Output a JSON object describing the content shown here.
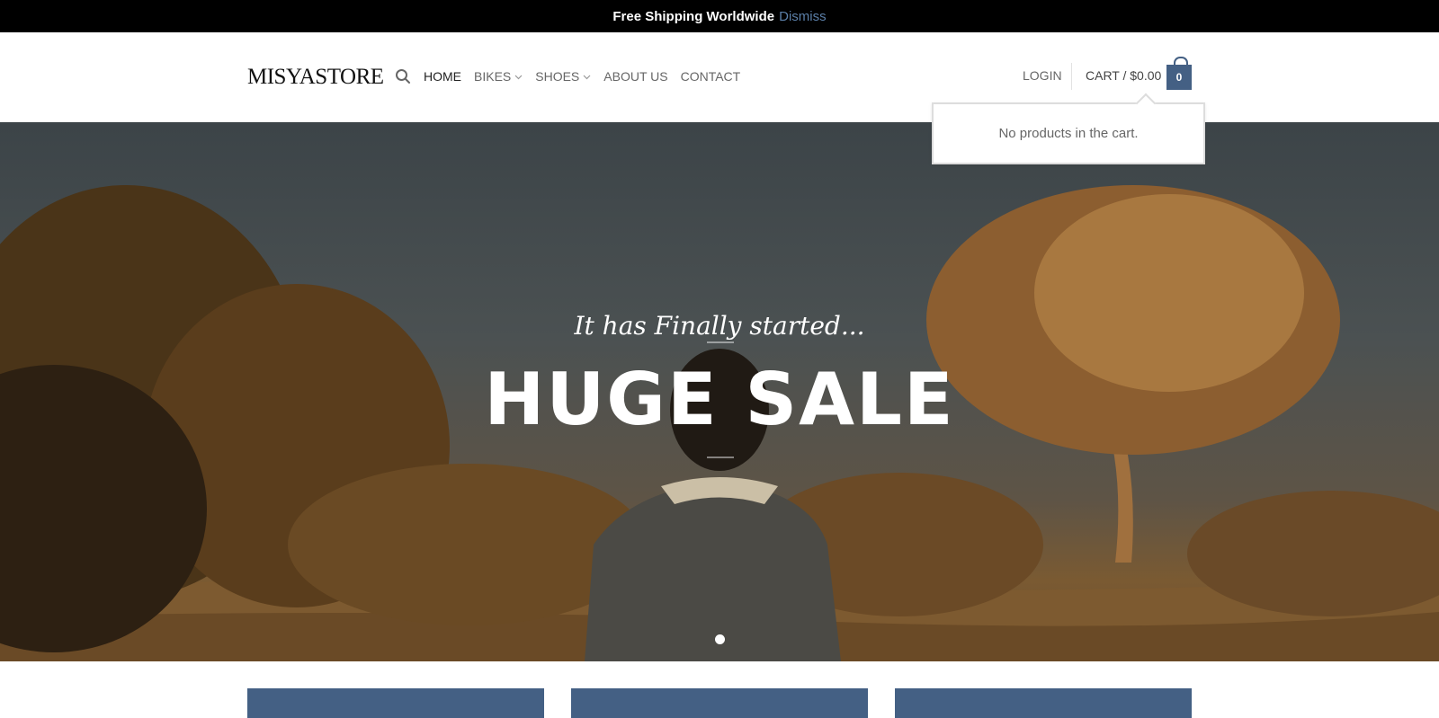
{
  "notice": {
    "text": "Free Shipping Worldwide",
    "dismiss": "Dismiss"
  },
  "header": {
    "logo": "MISYASTORE",
    "nav": [
      {
        "label": "HOME",
        "dropdown": false
      },
      {
        "label": "BIKES",
        "dropdown": true
      },
      {
        "label": "SHOES",
        "dropdown": true
      },
      {
        "label": "ABOUT US",
        "dropdown": false
      },
      {
        "label": "CONTACT",
        "dropdown": false
      }
    ],
    "login": "LOGIN",
    "cart_label": "CART / $0.00",
    "cart_count": "0"
  },
  "cart_dropdown": {
    "message": "No products in the cart."
  },
  "hero": {
    "kicker": "It has Finally started...",
    "title": "HUGE SALE"
  },
  "colors": {
    "accent": "#446084",
    "dismiss": "#5b7fa8"
  },
  "icons": [
    "search-icon",
    "chevron-down-icon",
    "cart-bag-icon"
  ]
}
